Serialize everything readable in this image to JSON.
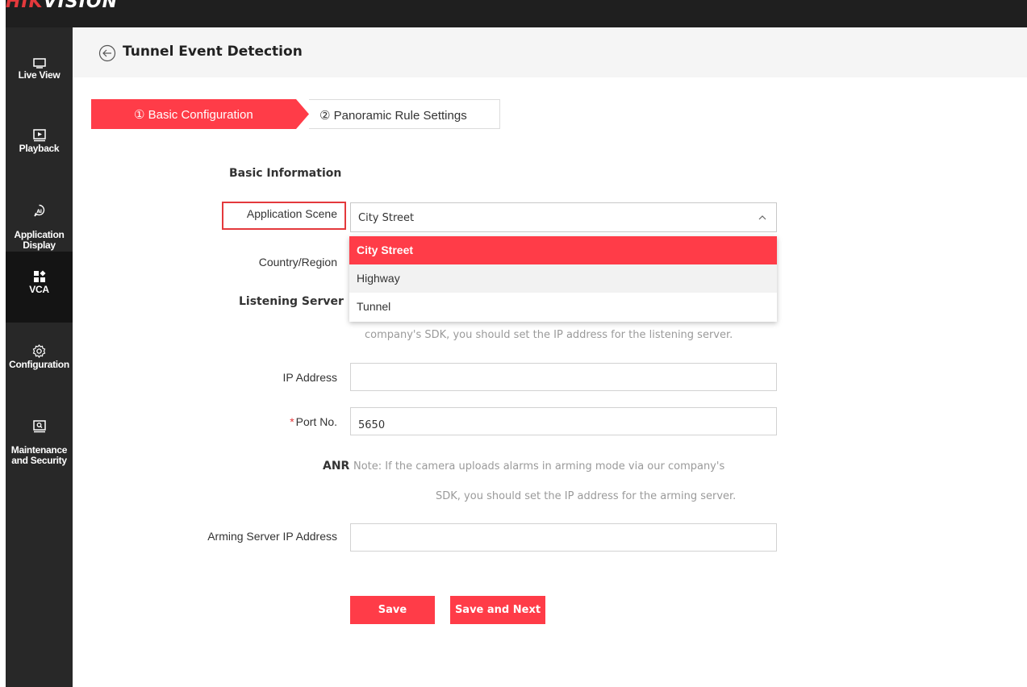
{
  "app": {
    "logo_text_a": "HIK",
    "logo_text_b": "VISION"
  },
  "sidebar": {
    "items": [
      {
        "label": "Live View",
        "icon": "monitor-icon"
      },
      {
        "label": "Playback",
        "icon": "play-screen-icon"
      },
      {
        "label": "Application\nDisplay",
        "icon": "ai-icon"
      },
      {
        "label": "VCA",
        "icon": "grid-icon",
        "active": true
      },
      {
        "label": "Configuration",
        "icon": "gear-icon"
      },
      {
        "label": "Maintenance\nand Security",
        "icon": "maintenance-icon"
      }
    ]
  },
  "header": {
    "title": "Tunnel Event Detection",
    "back_icon": "back-arrow-icon"
  },
  "steps": [
    {
      "label": "① Basic Configuration",
      "active": true
    },
    {
      "label": "② Panoramic Rule Settings",
      "active": false
    }
  ],
  "form": {
    "basic_info_title": "Basic Information",
    "application_scene": {
      "label": "Application Scene",
      "value": "City Street",
      "options": [
        "City Street",
        "Highway",
        "Tunnel"
      ],
      "selected_index": 0,
      "hover_index": 1
    },
    "country_region": {
      "label": "Country/Region"
    },
    "listening_server": {
      "title": "Listening Server",
      "note_line2": "company's SDK, you should set the IP address for the listening server."
    },
    "ip_address": {
      "label": "IP Address",
      "value": ""
    },
    "port_no": {
      "label": "Port No.",
      "required_mark": "*",
      "value": "5650"
    },
    "anr": {
      "title": "ANR",
      "note_line1": "Note: If the camera uploads alarms in arming mode via our company's",
      "note_line2": "SDK, you should set the IP address for the arming server."
    },
    "arming_server_ip": {
      "label": "Arming Server IP Address",
      "value": ""
    }
  },
  "buttons": {
    "save": "Save",
    "save_next": "Save and Next"
  },
  "colors": {
    "accent": "#ff3c48",
    "sidebar": "#282828",
    "topbar": "#1f1f1f",
    "highlight_border": "#e4393c"
  }
}
